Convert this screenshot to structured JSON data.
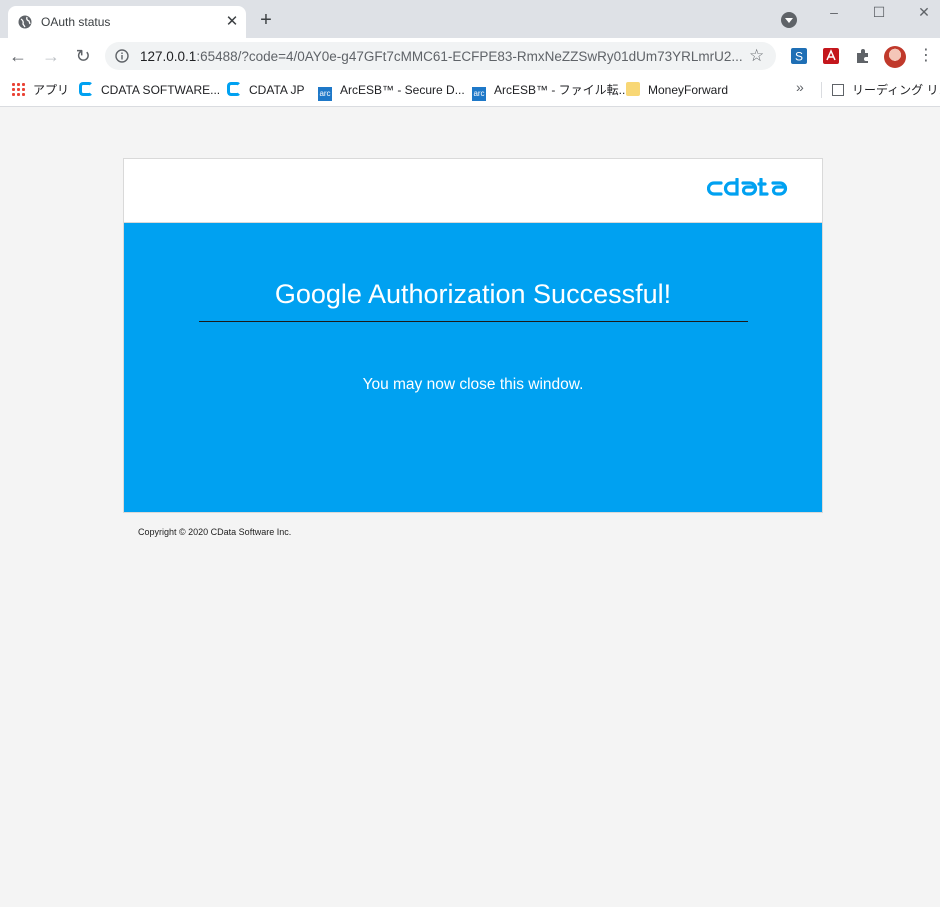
{
  "browser": {
    "tab": {
      "title": "OAuth status",
      "icon": "globe-icon"
    },
    "url": {
      "host": "127.0.0.1",
      "rest": ":65488/?code=4/0AY0e-g47GFt7cMMC61-ECFPE83-RmxNeZZSwRy01dUm73YRLmrU2..."
    },
    "bookmarks": [
      {
        "label": "アプリ",
        "icon": "apps-grid-icon"
      },
      {
        "label": "CDATA SOFTWARE...",
        "icon": "cdata-icon"
      },
      {
        "label": "CDATA JP",
        "icon": "cdata-icon"
      },
      {
        "label": "ArcESB™ - Secure D...",
        "icon": "arc-icon"
      },
      {
        "label": "ArcESB™ - ファイル転...",
        "icon": "arc-icon"
      },
      {
        "label": "MoneyForward",
        "icon": "folder-icon"
      }
    ],
    "reading_list": "リーディング リスト"
  },
  "page": {
    "logo": "cdata",
    "headline": "Google Authorization Successful!",
    "message": "You may now close this window.",
    "copyright": "Copyright © 2020 CData Software Inc.",
    "colors": {
      "accent": "#00a1f1",
      "background": "#f4f4f4"
    }
  }
}
